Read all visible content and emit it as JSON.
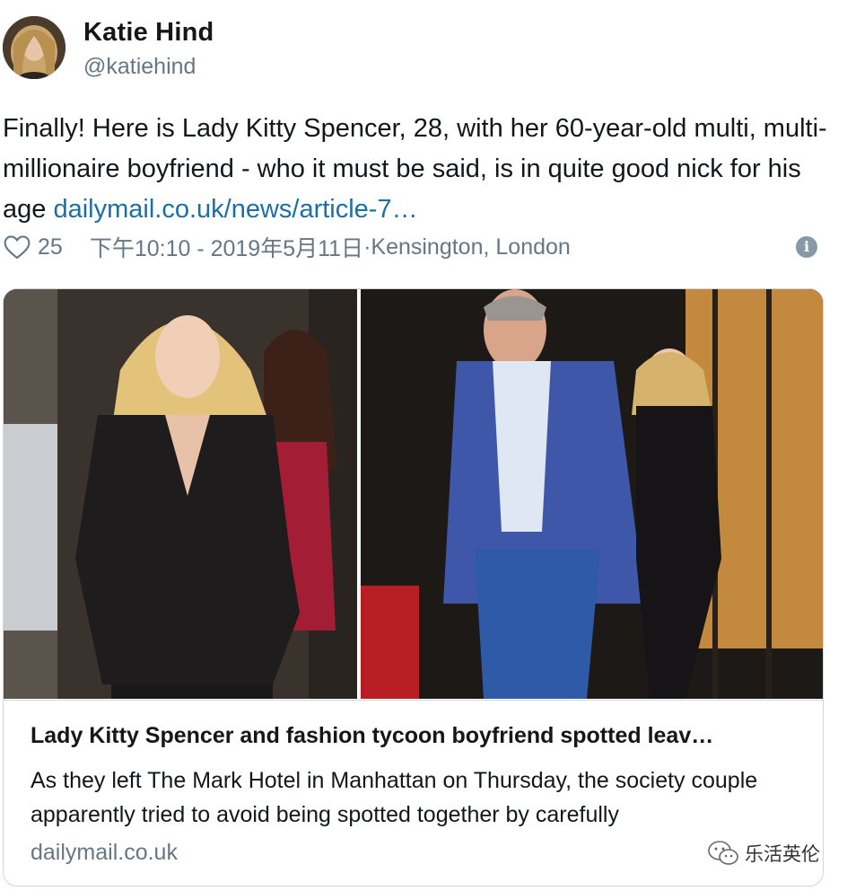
{
  "tweet": {
    "author_name": "Katie Hind",
    "author_handle": "@katiehind",
    "text": "Finally! Here is Lady Kitty Spencer, 28, with her 60-year-old multi, multi-millionaire boyfriend - who it must be said, is in quite good nick for his age ",
    "link_text": "dailymail.co.uk/news/article-7…",
    "likes": "25",
    "timestamp": "下午10:10 - 2019年5月11日",
    "location_sep": " · ",
    "location": "Kensington, London",
    "icons": {
      "like": "heart-outline-icon",
      "info": "info-icon"
    }
  },
  "card": {
    "title": "Lady Kitty Spencer and fashion tycoon boyfriend spotted leav…",
    "description": "As they left The Mark Hotel in Manhattan on Thursday, the society couple apparently tried to avoid being spotted together by carefully",
    "domain": "dailymail.co.uk"
  },
  "watermark": {
    "label": "乐活英伦"
  },
  "colors": {
    "link": "#1b6fa8",
    "secondary_text": "#657786",
    "border": "#ccd6dd"
  }
}
